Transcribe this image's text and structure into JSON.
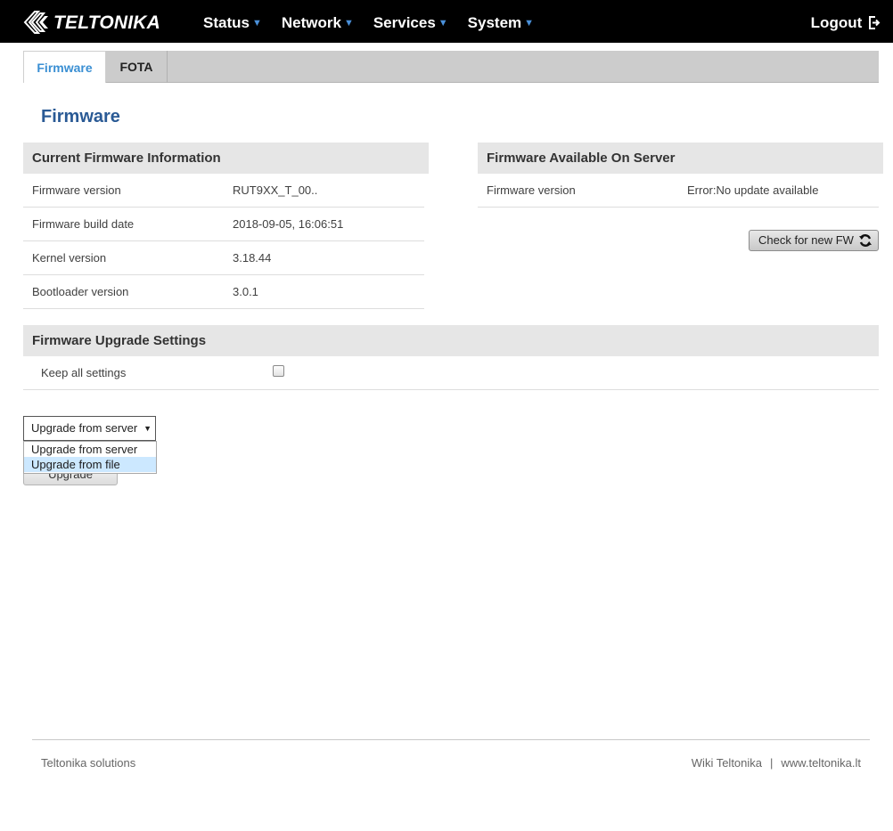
{
  "header": {
    "logo_text": "TELTONIKA",
    "nav": [
      {
        "label": "Status",
        "icon": "caret-down-icon"
      },
      {
        "label": "Network",
        "icon": "caret-down-icon"
      },
      {
        "label": "Services",
        "icon": "caret-down-icon"
      },
      {
        "label": "System",
        "icon": "caret-down-icon"
      }
    ],
    "logout_label": "Logout",
    "logout_icon": "logout-icon"
  },
  "tabs": [
    {
      "label": "Firmware",
      "active": true
    },
    {
      "label": "FOTA",
      "active": false
    }
  ],
  "page_title": "Firmware",
  "current_fw": {
    "title": "Current Firmware Information",
    "rows": [
      {
        "label": "Firmware version",
        "value": "RUT9XX_T_00.."
      },
      {
        "label": "Firmware build date",
        "value": "2018-09-05, 16:06:51"
      },
      {
        "label": "Kernel version",
        "value": "3.18.44"
      },
      {
        "label": "Bootloader version",
        "value": "3.0.1"
      }
    ]
  },
  "server_fw": {
    "title": "Firmware Available On Server",
    "rows": [
      {
        "label": "Firmware version",
        "value": "Error:No update available"
      }
    ],
    "check_button": "Check for new FW",
    "check_icon": "refresh-icon"
  },
  "upgrade_settings": {
    "title": "Firmware Upgrade Settings",
    "keep_settings_label": "Keep all settings",
    "keep_settings_checked": false
  },
  "upgrade": {
    "select_value": "Upgrade from server",
    "options": [
      "Upgrade from server",
      "Upgrade from file"
    ],
    "highlighted_option": "Upgrade from file",
    "button_label": "Upgrade"
  },
  "footer": {
    "left": "Teltonika solutions",
    "wiki": "Wiki Teltonika",
    "separator": "|",
    "site": "www.teltonika.lt"
  },
  "colors": {
    "header_bg": "#000000",
    "accent_blue": "#3a8fd3",
    "title_blue": "#2a5a95",
    "panel_head_bg": "#e6e6e6",
    "tabbar_bg": "#cccccc",
    "dropdown_highlight": "#cce8ff"
  }
}
